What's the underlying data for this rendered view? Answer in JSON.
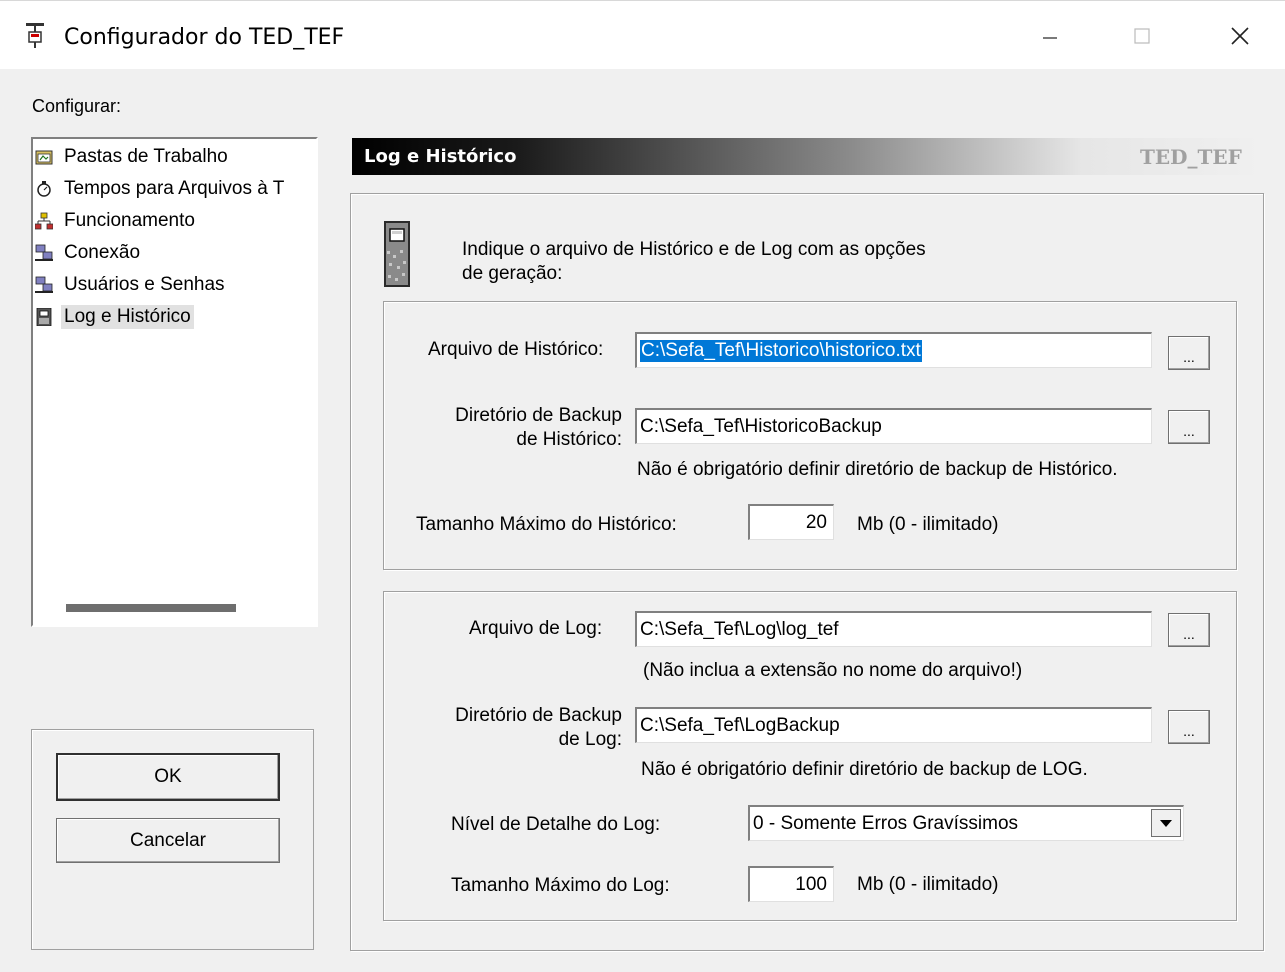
{
  "window": {
    "title": "Configurador do TED_TEF",
    "minimize_glyph": "—",
    "maximize_glyph": "☐",
    "close_glyph": "✕"
  },
  "sidebar": {
    "label": "Configurar:",
    "items": [
      {
        "label": "Pastas de Trabalho",
        "icon": "folder-icon"
      },
      {
        "label": "Tempos para Arquivos à T",
        "icon": "stopwatch-icon"
      },
      {
        "label": "Funcionamento",
        "icon": "network-icon"
      },
      {
        "label": "Conexão",
        "icon": "computers-icon"
      },
      {
        "label": "Usuários e Senhas",
        "icon": "computers-icon"
      },
      {
        "label": "Log e Histórico",
        "icon": "notebook-icon",
        "selected": true
      }
    ]
  },
  "buttons": {
    "ok": "OK",
    "cancel": "Cancelar"
  },
  "header": {
    "title": "Log e Histórico",
    "brand": "TED_TEF"
  },
  "intro": {
    "line1": "Indique o arquivo de Histórico e de Log com as opções",
    "line2": "de geração:"
  },
  "historico": {
    "file_label": "Arquivo de Histórico:",
    "file_value": "C:\\Sefa_Tef\\Historico\\historico.txt",
    "backup_label_1": "Diretório de Backup",
    "backup_label_2": "de Histórico:",
    "backup_value": "C:\\Sefa_Tef\\HistoricoBackup",
    "backup_note": "Não é obrigatório definir diretório de backup de Histórico.",
    "max_label": "Tamanho Máximo do Histórico:",
    "max_value": "20",
    "unit": "Mb  (0 - ilimitado)"
  },
  "log": {
    "file_label": "Arquivo de Log:",
    "file_value": "C:\\Sefa_Tef\\Log\\log_tef",
    "file_note": "(Não inclua a extensão no nome do arquivo!)",
    "backup_label_1": "Diretório de Backup",
    "backup_label_2": "de Log:",
    "backup_value": "C:\\Sefa_Tef\\LogBackup",
    "backup_note": "Não é obrigatório definir diretório de backup de LOG.",
    "level_label": "Nível de Detalhe do Log:",
    "level_value": "0 - Somente Erros Gravíssimos",
    "max_label": "Tamanho Máximo do Log:",
    "max_value": "100",
    "unit": "Mb  (0 - ilimitado)"
  },
  "browse_label": "..."
}
